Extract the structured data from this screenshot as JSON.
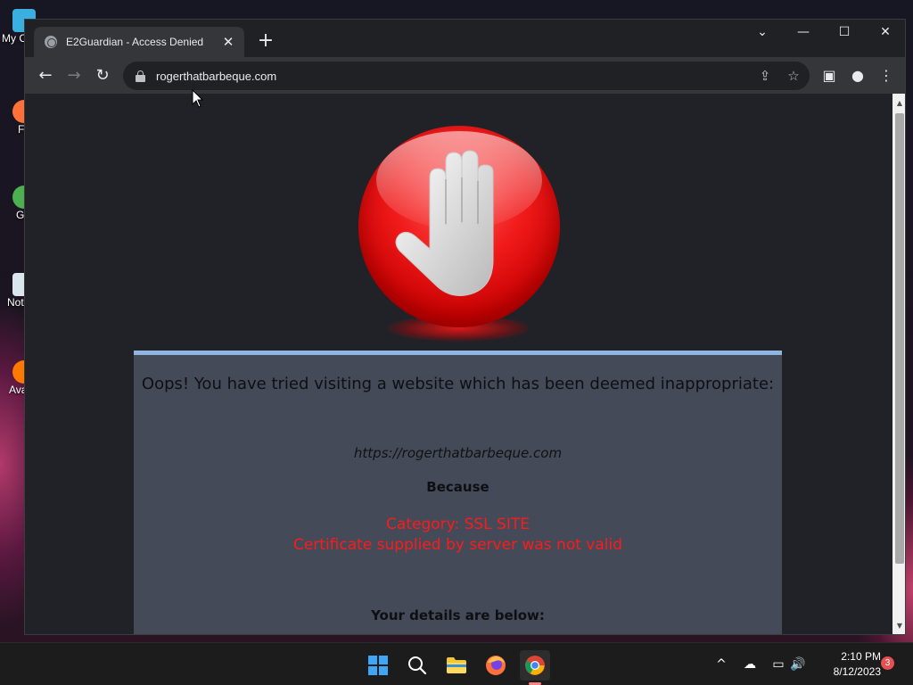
{
  "desktop": {
    "icons": [
      {
        "label": "My C",
        "icon": "computer-icon",
        "color": "#3ab0e0"
      },
      {
        "label": "F",
        "icon": "firefox-icon",
        "color": "#ff7139"
      },
      {
        "label": "G C",
        "icon": "chrome-icon",
        "color": "#4caf50"
      },
      {
        "label": "Not",
        "icon": "notepad-icon",
        "color": "#d9e6ee"
      },
      {
        "label": "Ava An",
        "icon": "avast-icon",
        "color": "#ff7800"
      }
    ]
  },
  "browser": {
    "tab": {
      "title": "E2Guardian - Access Denied",
      "close": "✕"
    },
    "new_tab": "+",
    "window_controls": {
      "dropdown": "⌄",
      "minimize": "—",
      "maximize": "☐",
      "close": "✕"
    },
    "nav": {
      "back": "←",
      "forward": "→",
      "reload": "↻"
    },
    "url": "rogerthatbarbeque.com",
    "omnibox_icons": {
      "share": "⇪",
      "bookmark": "☆"
    },
    "toolbar_icons": {
      "side_panel": "▣",
      "profile": "●",
      "menu": "⋮"
    }
  },
  "page": {
    "heading": "Oops! You have tried visiting a website which has been deemed inappropriate:",
    "blocked_url": "https://rogerthatbarbeque.com",
    "because": "Because",
    "reason_category": "Category: SSL SITE",
    "reason_detail": "Certificate supplied by server was not valid",
    "details_heading": "Your details are below:",
    "accent_color": "#8fb6e0",
    "reason_color": "#ff1a1a"
  },
  "taskbar": {
    "apps": [
      "start-icon",
      "search-icon",
      "file-explorer-icon",
      "firefox-icon",
      "chrome-icon"
    ],
    "tray": {
      "chevron": "^",
      "onedrive": "☁",
      "network": "▭",
      "volume": "🔊"
    },
    "time": "2:10 PM",
    "date": "8/12/2023",
    "notifications": "3"
  }
}
